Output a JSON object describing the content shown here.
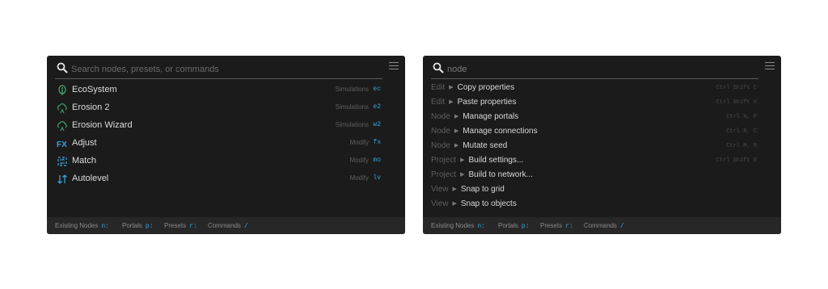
{
  "left_panel": {
    "search": {
      "value": "",
      "placeholder": "Search nodes, presets, or commands"
    },
    "items": [
      {
        "label": "EcoSystem",
        "category": "Simulations",
        "shortcut": "ec",
        "icon": "leaf-icon",
        "icon_color": "#4aa06a"
      },
      {
        "label": "Erosion 2",
        "category": "Simulations",
        "shortcut": "e2",
        "icon": "cloud-terrain-icon",
        "icon_color": "#3f9b67"
      },
      {
        "label": "Erosion Wizard",
        "category": "Simulations",
        "shortcut": "w2",
        "icon": "cloud-terrain-icon",
        "icon_color": "#3f9b67"
      },
      {
        "label": "Adjust",
        "category": "Modify",
        "shortcut": "fx",
        "icon": "fx-icon",
        "icon_color": "#3aa3d4"
      },
      {
        "label": "Match",
        "category": "Modify",
        "shortcut": "mo",
        "icon": "swap-frame-icon",
        "icon_color": "#3aa3d4"
      },
      {
        "label": "Autolevel",
        "category": "Modify",
        "shortcut": "lv",
        "icon": "level-arrows-icon",
        "icon_color": "#3aa3d4"
      }
    ],
    "footer": [
      {
        "label": "Existing Nodes",
        "key": "n:"
      },
      {
        "label": "Portals",
        "key": "p:"
      },
      {
        "label": "Presets",
        "key": "r:"
      },
      {
        "label": "Commands",
        "key": "/"
      }
    ]
  },
  "right_panel": {
    "search": {
      "value": "node",
      "placeholder": ""
    },
    "commands": [
      {
        "context": "Edit",
        "command": "Copy properties",
        "keys": "Ctrl Shift C"
      },
      {
        "context": "Edit",
        "command": "Paste properties",
        "keys": "Ctrl Shift V"
      },
      {
        "context": "Node",
        "command": "Manage portals",
        "keys": "Ctrl N, P"
      },
      {
        "context": "Node",
        "command": "Manage connections",
        "keys": "Ctrl N, C"
      },
      {
        "context": "Node",
        "command": "Mutate seed",
        "keys": "Ctrl M, M"
      },
      {
        "context": "Project",
        "command": "Build settings...",
        "keys": "Ctrl Shift B"
      },
      {
        "context": "Project",
        "command": "Build to network...",
        "keys": ""
      },
      {
        "context": "View",
        "command": "Snap to grid",
        "keys": ""
      },
      {
        "context": "View",
        "command": "Snap to objects",
        "keys": ""
      }
    ],
    "footer": [
      {
        "label": "Existing Nodes",
        "key": "n:"
      },
      {
        "label": "Portals",
        "key": "p:"
      },
      {
        "label": "Presets",
        "key": "r:"
      },
      {
        "label": "Commands",
        "key": "/"
      }
    ]
  },
  "arrow_glyph": "▶",
  "colors": {
    "panel_bg": "#1b1b1c",
    "footer_bg": "#272728",
    "accent": "#3aa3d4",
    "green": "#3f9b67"
  }
}
